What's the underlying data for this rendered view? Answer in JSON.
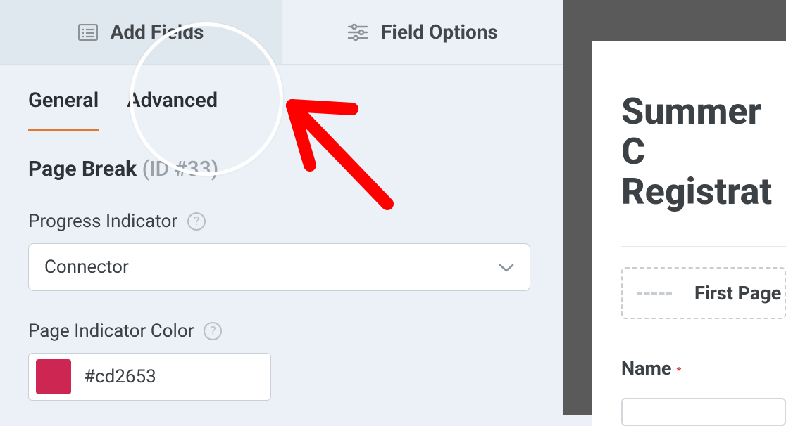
{
  "topTabs": {
    "addFields": "Add Fields",
    "fieldOptions": "Field Options"
  },
  "subTabs": {
    "general": "General",
    "advanced": "Advanced"
  },
  "section": {
    "title": "Page Break",
    "idLabel": "(ID #33)"
  },
  "progressIndicator": {
    "label": "Progress Indicator",
    "value": "Connector"
  },
  "pageIndicatorColor": {
    "label": "Page Indicator Color",
    "value": "#cd2653",
    "swatch": "#cd2653"
  },
  "preview": {
    "titleLine1": "Summer C",
    "titleLine2": "Registrat",
    "firstPage": "First Page",
    "nameLabel": "Name",
    "requiredMark": "*"
  }
}
